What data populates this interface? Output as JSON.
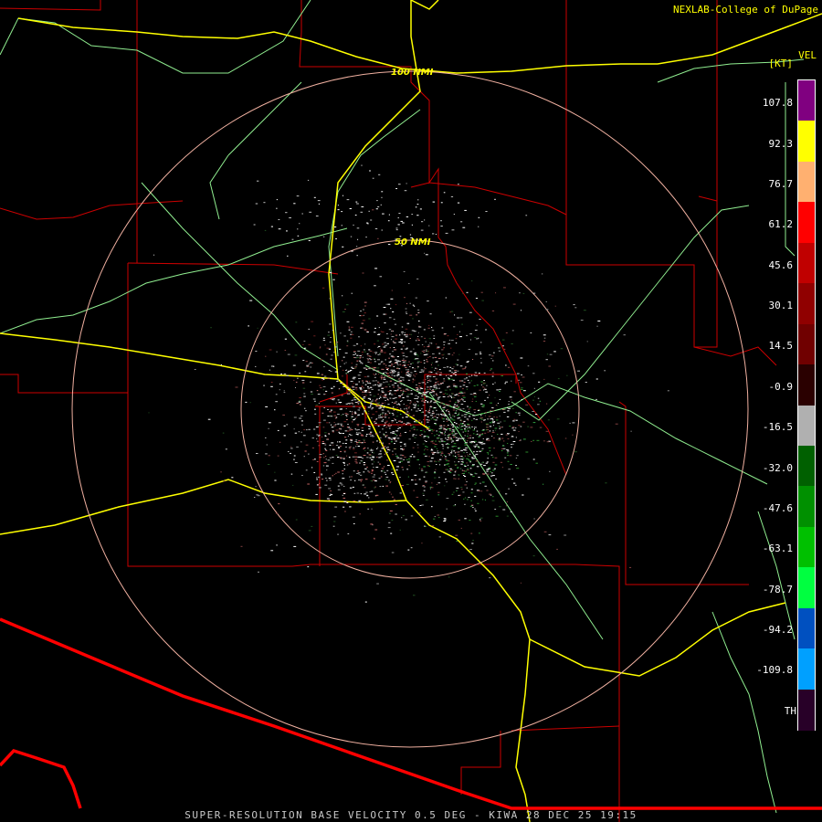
{
  "credit": "NEXLAB-College of DuPage",
  "product": {
    "code": "VEL",
    "units": "[KT]",
    "title": "SUPER-RESOLUTION BASE VELOCITY 0.5 DEG - KIWA 28 DEC 25 19:15"
  },
  "range_rings": [
    "50 NMI",
    "100 NMI"
  ],
  "legend": {
    "ticks": [
      "107.8",
      "92.3",
      "76.7",
      "61.2",
      "45.6",
      "30.1",
      "14.5",
      "-0.9",
      "-16.5",
      "-32.0",
      "-47.6",
      "-63.1",
      "-78.7",
      "-94.2",
      "-109.8",
      "TH"
    ],
    "colors": [
      "#800080",
      "#ffff00",
      "#ffb070",
      "#ff0000",
      "#c00000",
      "#900000",
      "#700000",
      "#2a0000",
      "#b0b0b0",
      "#006000",
      "#009000",
      "#00c000",
      "#00ff40",
      "#0050c0",
      "#00a0ff",
      "#280028"
    ]
  },
  "colors": {
    "counties": "#cc0000",
    "state_line": "#ff0000",
    "interstates": "#ffff00",
    "highways": "#90ee90",
    "rings": "#f0b0a0"
  }
}
